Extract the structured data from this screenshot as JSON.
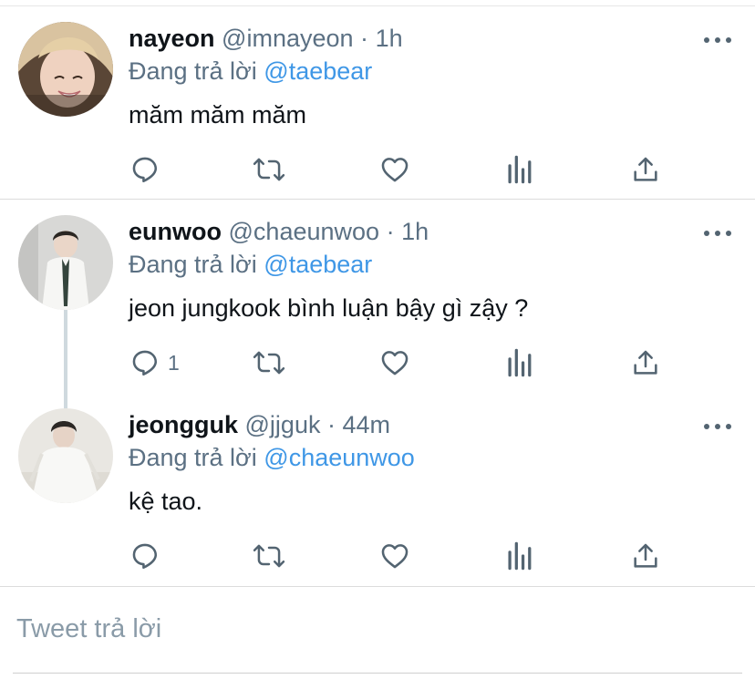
{
  "tweets": [
    {
      "name": "nayeon",
      "handle": "@imnayeon",
      "sep": "·",
      "time": "1h",
      "replying_prefix": "Đang trả lời",
      "replying_to": "@taebear",
      "text": "măm măm măm",
      "reply_count": ""
    },
    {
      "name": "eunwoo",
      "handle": "@chaeunwoo",
      "sep": "·",
      "time": "1h",
      "replying_prefix": "Đang trả lời",
      "replying_to": "@taebear",
      "text": "jeon jungkook bình luận bậy gì zậy ?",
      "reply_count": "1"
    },
    {
      "name": "jeongguk",
      "handle": "@jjguk",
      "sep": "·",
      "time": "44m",
      "replying_prefix": "Đang trả lời",
      "replying_to": "@chaeunwoo",
      "text": "kệ tao.",
      "reply_count": ""
    }
  ],
  "compose": {
    "placeholder": "Tweet trả lời"
  },
  "colors": {
    "link": "#3f97e6",
    "muted": "#5b7083",
    "icon": "#536471"
  },
  "icons": [
    "reply-icon",
    "retweet-icon",
    "like-icon",
    "analytics-icon",
    "share-icon",
    "more-icon"
  ]
}
